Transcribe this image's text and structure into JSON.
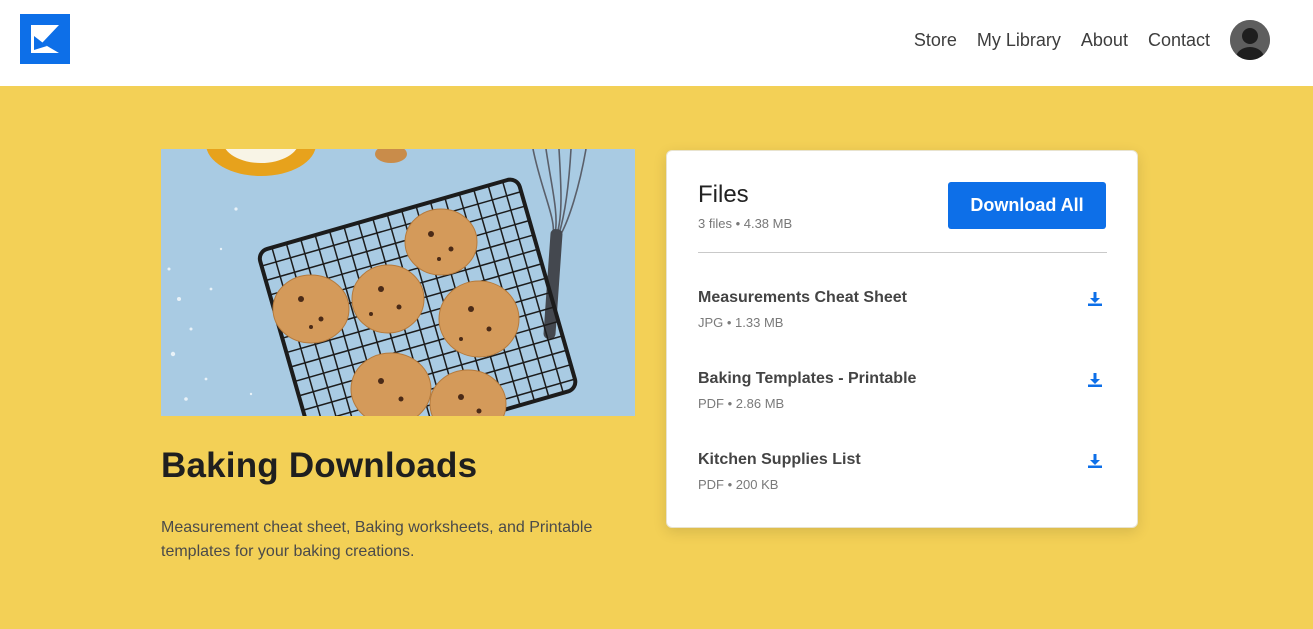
{
  "brand": {
    "logo": "brand-logo-icon",
    "accent": "#0d6fe8",
    "background": "#f3d056"
  },
  "nav": {
    "items": [
      {
        "label": "Store"
      },
      {
        "label": "My Library"
      },
      {
        "label": "About"
      },
      {
        "label": "Contact"
      }
    ],
    "avatar": "user-avatar"
  },
  "hero": {
    "image": "cookies-on-cooling-rack-photo"
  },
  "product": {
    "title": "Baking Downloads",
    "description": "Measurement cheat sheet, Baking worksheets, and Printable templates for your baking creations."
  },
  "files": {
    "heading": "Files",
    "summary": "3 files • 4.38 MB",
    "download_all_label": "Download All",
    "items": [
      {
        "name": "Measurements Cheat Sheet",
        "meta": "JPG • 1.33 MB",
        "icon": "download-icon"
      },
      {
        "name": "Baking Templates - Printable",
        "meta": "PDF • 2.86 MB",
        "icon": "download-icon"
      },
      {
        "name": "Kitchen Supplies List",
        "meta": "PDF • 200 KB",
        "icon": "download-icon"
      }
    ]
  }
}
